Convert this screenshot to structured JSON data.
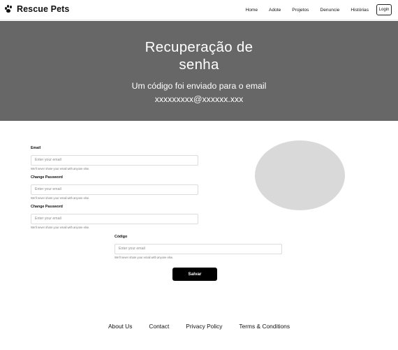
{
  "nav": {
    "brand": "Rescue Pets",
    "logo_icon": "paw-icon",
    "links": [
      "Home",
      "Adote",
      "Projetos",
      "Denuncie",
      "Histórias"
    ],
    "login_label": "Login"
  },
  "hero": {
    "title": "Recuperação de senha",
    "subtitle_line1": "Um código foi enviado para o email",
    "subtitle_line2": "xxxxxxxxx@xxxxxx.xxx",
    "background": "#676767"
  },
  "form": {
    "email": {
      "label": "Email",
      "placeholder": "Enter your email",
      "help": "We'll never share your email with anyone else."
    },
    "change_password_1": {
      "label": "Change Password",
      "placeholder": "Enter your email",
      "help": "We'll never share your email with anyone else."
    },
    "change_password_2": {
      "label": "Change Password",
      "placeholder": "Enter your email",
      "help": "We'll never share your email with anyone else."
    },
    "codigo": {
      "label": "Código",
      "placeholder": "Enter your email",
      "help": "We'll never share your email with anyone else."
    },
    "save_label": "Salvar"
  },
  "footer": {
    "links": [
      "About Us",
      "Contact",
      "Privacy Policy",
      "Terms & Conditions"
    ]
  }
}
